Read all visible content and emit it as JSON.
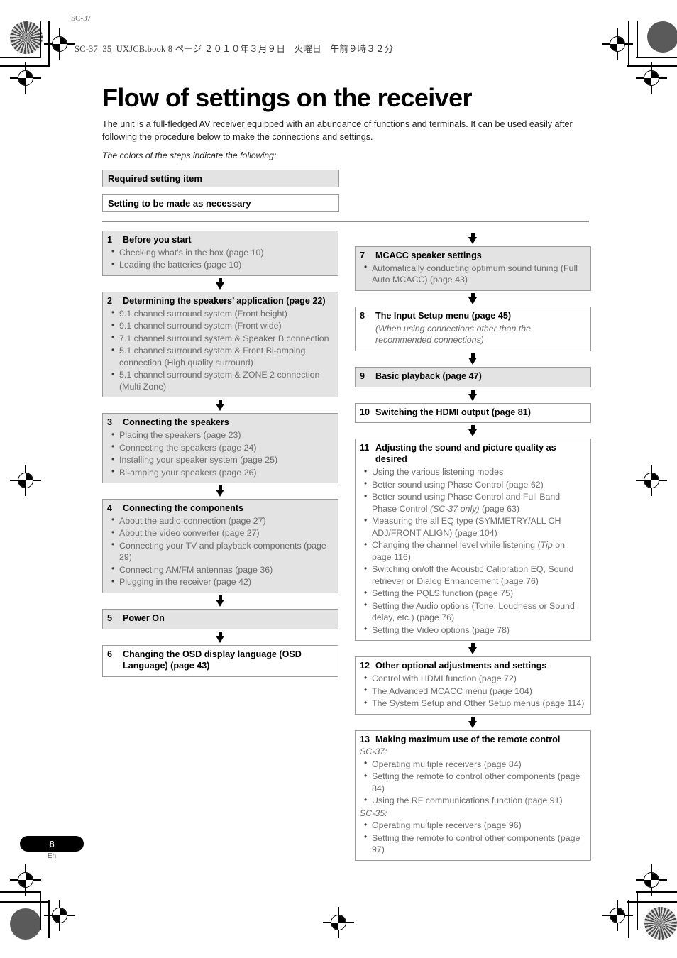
{
  "print_marks": {
    "book_header": "SC-37_35_UXJCB.book  8 ページ  ２０１０年３月９日　火曜日　午前９時３２分",
    "corner_label": "SC-37"
  },
  "page": {
    "title": "Flow of settings on the receiver",
    "intro": "The unit is a full-fledged AV receiver equipped with an abundance of functions and terminals. It can be used easily after following the procedure below to make the connections and settings.",
    "intro_italic": "The colors of the steps indicate the following:",
    "number": "8",
    "language": "En"
  },
  "legend": {
    "required": "Required setting item",
    "optional": "Setting to be made as necessary"
  },
  "colors": {
    "required_fill": "#e3e3e3",
    "optional_fill": "#ffffff",
    "box_border": "#9b9b9b",
    "bullet_text": "#6d6d6d",
    "heading_text": "#000000"
  },
  "steps_left": [
    {
      "num": "1",
      "title": "Before you start",
      "fill": "required",
      "items": [
        "Checking what's in the box (page 10)",
        "Loading the batteries (page 10)"
      ]
    },
    {
      "num": "2",
      "title": "Determining the speakers’ application (page 22)",
      "fill": "required",
      "items": [
        "9.1 channel surround system (Front height)",
        "9.1 channel surround system (Front wide)",
        "7.1 channel surround system & Speaker B connection",
        "5.1 channel surround system & Front Bi-amping connection (High quality surround)",
        "5.1 channel surround system & ZONE 2 connection (Multi Zone)"
      ]
    },
    {
      "num": "3",
      "title": "Connecting the speakers",
      "fill": "required",
      "items": [
        "Placing the speakers (page 23)",
        "Connecting the speakers (page 24)",
        "Installing your speaker system (page 25)",
        "Bi-amping your speakers (page 26)"
      ]
    },
    {
      "num": "4",
      "title": "Connecting the components",
      "fill": "required",
      "items": [
        "About the audio connection (page 27)",
        "About the video converter (page 27)",
        "Connecting your TV and playback components (page 29)",
        "Connecting AM/FM antennas (page 36)",
        "Plugging in the receiver (page 42)"
      ]
    },
    {
      "num": "5",
      "title": "Power On",
      "fill": "required",
      "items": []
    },
    {
      "num": "6",
      "title": "Changing the OSD display language (OSD Language) (page 43)",
      "fill": "optional",
      "items": []
    }
  ],
  "steps_right": [
    {
      "num": "7",
      "title": "MCACC speaker settings",
      "fill": "required",
      "items": [
        "Automatically conducting optimum sound tuning (Full Auto MCACC) (page 43)"
      ]
    },
    {
      "num": "8",
      "title": "The Input Setup menu (page 45)",
      "fill": "optional",
      "note": "(When using connections other than the recommended connections)",
      "items": []
    },
    {
      "num": "9",
      "title": "Basic playback (page 47)",
      "fill": "required",
      "items": []
    },
    {
      "num": "10",
      "title": "Switching the HDMI output (page 81)",
      "fill": "optional",
      "items": []
    },
    {
      "num": "11",
      "title": "Adjusting the sound and picture quality as desired",
      "fill": "optional",
      "items": [
        "Using the various listening modes",
        "Better sound using Phase Control (page 62)",
        "Better sound using Phase Control and Full Band Phase Control (SC-37 only) (page 63)",
        "Measuring the all EQ type (SYMMETRY/ALL CH ADJ/FRONT ALIGN) (page 104)",
        "Changing the channel level while listening (Tip on page 116)",
        "Switching on/off the Acoustic Calibration EQ, Sound retriever or Dialog Enhancement (page 76)",
        "Setting the PQLS function (page 75)",
        "Setting the Audio options (Tone, Loudness or Sound delay, etc.) (page 76)",
        "Setting the Video options (page 78)"
      ]
    },
    {
      "num": "12",
      "title": "Other optional adjustments and settings",
      "fill": "optional",
      "items": [
        "Control with HDMI function (page 72)",
        "The Advanced MCACC menu (page 104)",
        "The System Setup and Other Setup menus (page 114)"
      ]
    },
    {
      "num": "13",
      "title": "Making maximum use of the remote control",
      "fill": "optional",
      "groups": [
        {
          "label": "SC-37:",
          "items": [
            "Operating multiple receivers (page 84)",
            "Setting the remote to control other components (page 84)",
            "Using the RF communications function (page 91)"
          ]
        },
        {
          "label": "SC-35:",
          "items": [
            "Operating multiple receivers (page 96)",
            "Setting the remote to control other components (page 97)"
          ]
        }
      ],
      "items": []
    }
  ]
}
